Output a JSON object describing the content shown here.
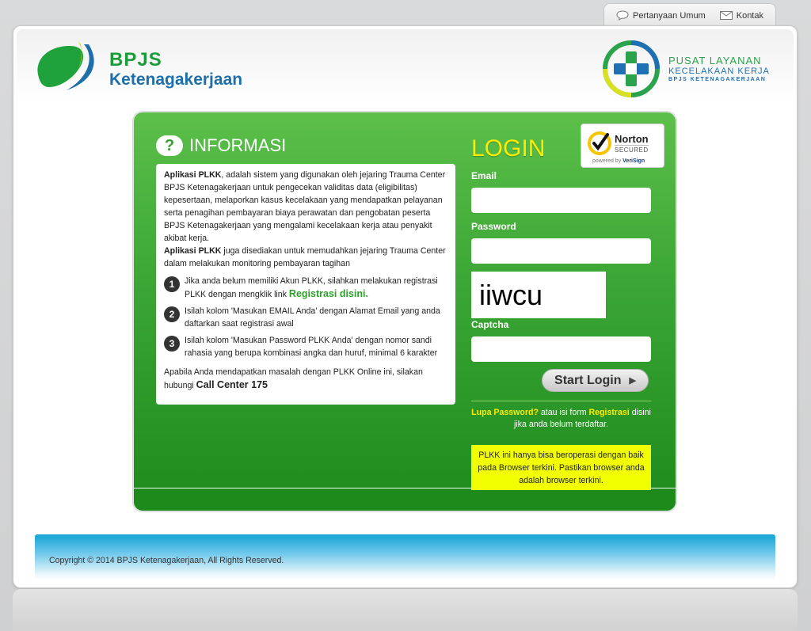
{
  "top_nav": {
    "faq_label": "Pertanyaan Umum",
    "contact_label": "Kontak"
  },
  "header": {
    "brand_line1": "BPJS",
    "brand_line2": "Ketenagakerjaan",
    "right_logo_line1": "PUSAT LAYANAN",
    "right_logo_line2": "KECELAKAAN KERJA",
    "right_logo_line3": "BPJS KETENAGAKERJAAN"
  },
  "info": {
    "icon": "?",
    "title": "INFORMASI",
    "p1_bold": "Aplikasi PLKK",
    "p1_text": ", adalah sistem yang digunakan oleh jejaring Trauma Center BPJS Ketenagakerjaan untuk pengecekan validitas data (eligibilitas) kepesertaan, melaporkan kasus kecelakaan yang mendapatkan pelayanan serta penagihan pembayaran biaya perawatan dan pengobatan peserta BPJS Ketenagakerjaan yang mengalami kecelakaan kerja atau penyakit akibat kerja.",
    "p2_bold": "Aplikasi PLKK",
    "p2_text": " juga disediakan untuk memudahkan jejaring Trauma Center dalam melakukan monitoring pembayaran tagihan",
    "steps": [
      {
        "num": "1",
        "text": "Jika anda belum memiliki Akun PLKK, silahkan melakukan registrasi PLKK dengan mengklik link ",
        "link": "Registrasi disini."
      },
      {
        "num": "2",
        "text": "Isilah kolom 'Masukan EMAIL Anda' dengan Alamat Email yang anda daftarkan saat registrasi awal"
      },
      {
        "num": "3",
        "text": "Isilah kolom 'Masukan Password PLKK Anda' dengan nomor sandi rahasia yang berupa kombinasi angka dan huruf, minimal 6 karakter"
      }
    ],
    "footer_text": "Apabila Anda mendapatkan masalah dengan PLKK Online ini, silakan hubungi ",
    "footer_call": "Call Center 175"
  },
  "login": {
    "title": "LOGIN",
    "email_label": "Email",
    "email_value": "",
    "password_label": "Password",
    "password_value": "",
    "captcha_image_text": "iiwcu",
    "captcha_label": "Captcha",
    "captcha_value": "",
    "submit_label": "Start Login",
    "submit_arrow": "▶",
    "forgot_link": "Lupa Password?",
    "forgot_mid": " atau isi form ",
    "register_link": "Registrasi",
    "forgot_tail": " disini jika anda belum terdaftar.",
    "notice": "PLKK ini hanya bisa beroperasi dengan baik pada Browser terkini. Pastikan browser anda adalah browser terkini."
  },
  "norton": {
    "line1": "Norton",
    "line2": "SECURED",
    "line3_pre": "powered by ",
    "line3_brand": "VeriSign"
  },
  "footer": {
    "copyright": "Copyright © 2014 BPJS Ketenagakerjaan, All Rights Reserved."
  },
  "colors": {
    "brand_green": "#1c9b3b",
    "brand_blue": "#1d6faa",
    "login_yellow": "#ffeb00",
    "notice_yellow": "#f2ff00"
  }
}
